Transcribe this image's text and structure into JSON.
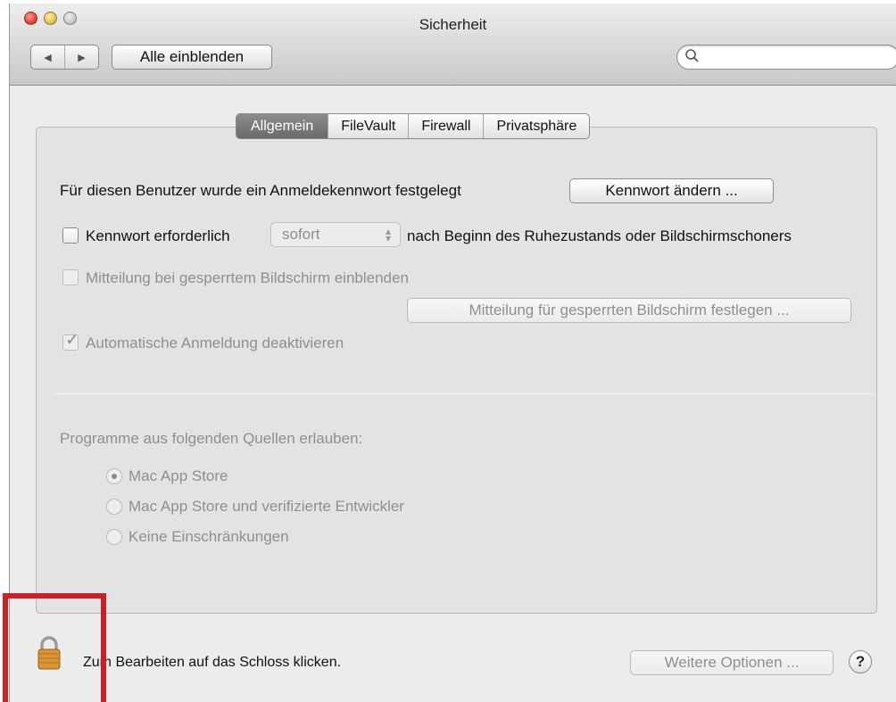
{
  "window": {
    "title": "Sicherheit",
    "nav_back": "◀",
    "nav_forward": "▶",
    "show_all_label": "Alle einblenden",
    "search_placeholder": ""
  },
  "tabs": [
    {
      "label": "Allgemein",
      "active": true
    },
    {
      "label": "FileVault",
      "active": false
    },
    {
      "label": "Firewall",
      "active": false
    },
    {
      "label": "Privatsphäre",
      "active": false
    }
  ],
  "general": {
    "password_set_text": "Für diesen Benutzer wurde ein Anmeldekennwort festgelegt",
    "change_password_label": "Kennwort ändern ...",
    "require_password_label": "Kennwort erforderlich",
    "require_password_checked": false,
    "delay_option": "sofort",
    "require_password_suffix": "nach Beginn des Ruhezustands oder Bildschirmschoners",
    "show_message_label": "Mitteilung bei gesperrtem Bildschirm einblenden",
    "set_message_label": "Mitteilung für gesperrten Bildschirm festlegen ...",
    "disable_autologin_label": "Automatische Anmeldung deaktivieren",
    "disable_autologin_checked": true
  },
  "sources": {
    "heading": "Programme aus folgenden Quellen erlauben:",
    "options": [
      {
        "label": "Mac App Store",
        "selected": true
      },
      {
        "label": "Mac App Store und verifizierte Entwickler",
        "selected": false
      },
      {
        "label": "Keine Einschränkungen",
        "selected": false
      }
    ]
  },
  "footer": {
    "lock_text": "Zum Bearbeiten auf das Schloss klicken.",
    "more_options_label": "Weitere Optionen ...",
    "help_label": "?"
  },
  "colors": {
    "highlight_box": "#cc1f26",
    "active_tab": "#7a7a7a"
  }
}
